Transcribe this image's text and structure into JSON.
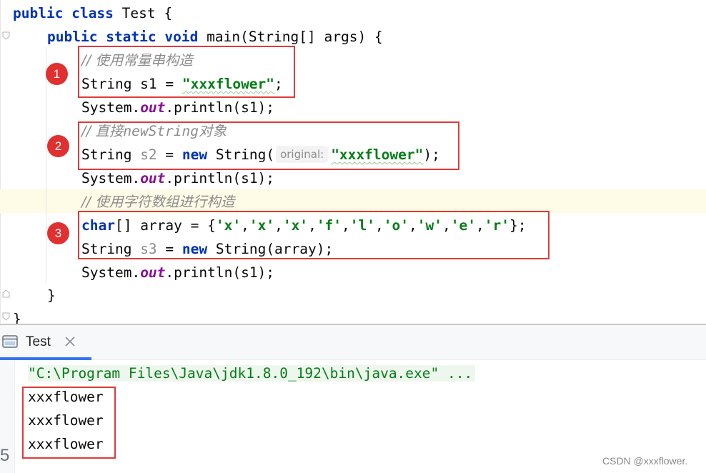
{
  "editor": {
    "lines": {
      "l1": {
        "kw1": "public",
        "kw2": "class",
        "name": "Test {"
      },
      "l2": {
        "kw1": "public",
        "kw2": "static",
        "kw3": "void",
        "rest": "main(String[] args) {"
      },
      "l3": {
        "comment": "// 使用常量串构造"
      },
      "l4": {
        "decl": "String s1 = ",
        "str": "\"xxxflower\"",
        "end": ";"
      },
      "l5": {
        "pre": "System.",
        "field": "out",
        "post": ".println(s1);"
      },
      "l6": {
        "prefix": "// 直接",
        "cjk_mid": "newString",
        "suffix": "对象"
      },
      "l7": {
        "decl": "String ",
        "var": "s2",
        "eq": " = ",
        "kw": "new",
        "type": " String(",
        "hint": "original:",
        "str": "\"xxxflower\"",
        "end": ");"
      },
      "l8": {
        "pre": "System.",
        "field": "out",
        "post": ".println(s1);"
      },
      "l9": {
        "comment": "// 使用字符数组进行构造"
      },
      "l10": {
        "kw": "char",
        "decl": "[] array = {",
        "chars": [
          "'x'",
          "'x'",
          "'x'",
          "'f'",
          "'l'",
          "'o'",
          "'w'",
          "'e'",
          "'r'"
        ],
        "sep": ",",
        "end": "};"
      },
      "l11": {
        "decl": "String ",
        "var": "s3",
        "eq": " = ",
        "kw": "new",
        "rest": " String(array);"
      },
      "l12": {
        "pre": "System.",
        "field": "out",
        "post": ".println(s1);"
      },
      "l13": {
        "text": "}"
      },
      "l14": {
        "text": "}"
      }
    }
  },
  "markers": [
    "1",
    "2",
    "3"
  ],
  "run_panel": {
    "tab_label": "Test",
    "tab_icon": "run-config-icon",
    "close_icon": "close-icon",
    "command": "\"C:\\Program Files\\Java\\jdk1.8.0_192\\bin\\java.exe\" ...",
    "output": [
      "xxxflower",
      "xxxflower",
      "xxxflower"
    ],
    "side_glyph": "5"
  },
  "watermark": "CSDN @xxxflower.",
  "colors": {
    "keyword": "#0033b3",
    "string": "#067d17",
    "comment": "#8c8c8c",
    "static_field": "#871094",
    "highlight_box": "#e03a3a",
    "marker": "#e03030",
    "active_tab": "#3574f0",
    "caret_row": "#fefbe6"
  }
}
